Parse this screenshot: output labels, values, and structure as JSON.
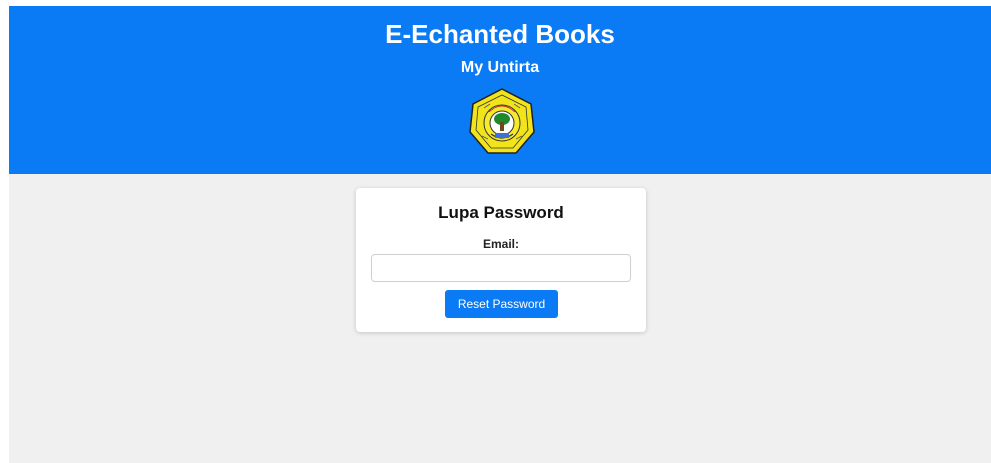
{
  "header": {
    "title": "E-Echanted Books",
    "subtitle": "My Untirta",
    "logo_icon": "university-seal-icon",
    "logo_text": "UNIVERSITAS SULTAN AGENG TIRTAYASA",
    "background_color": "#0a7bf5"
  },
  "form": {
    "title": "Lupa Password",
    "email_label": "Email:",
    "email_value": "",
    "email_placeholder": "",
    "submit_label": "Reset Password",
    "button_color": "#0a7bf5"
  },
  "page": {
    "background_color": "#f0f0f0"
  }
}
